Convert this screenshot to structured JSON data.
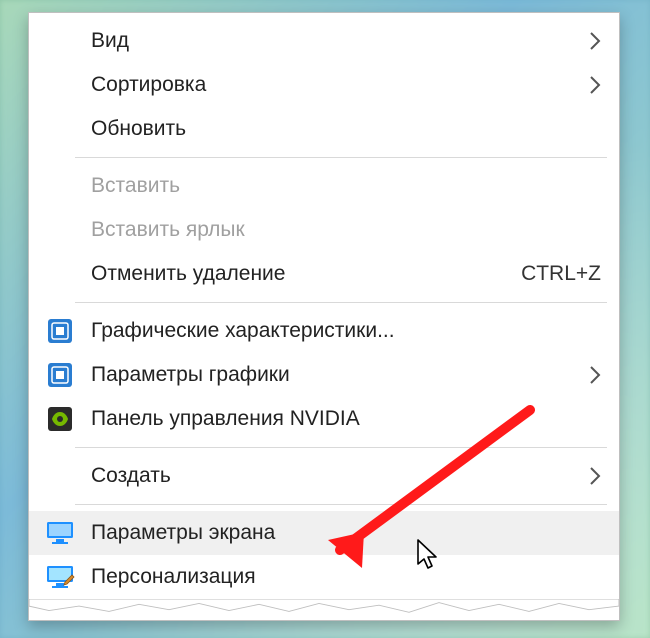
{
  "menu": {
    "items": [
      {
        "label": "Вид",
        "submenu": true,
        "enabled": true,
        "icon": null
      },
      {
        "label": "Сортировка",
        "submenu": true,
        "enabled": true,
        "icon": null
      },
      {
        "label": "Обновить",
        "submenu": false,
        "enabled": true,
        "icon": null
      },
      {
        "sep": true
      },
      {
        "label": "Вставить",
        "submenu": false,
        "enabled": false,
        "icon": null
      },
      {
        "label": "Вставить ярлык",
        "submenu": false,
        "enabled": false,
        "icon": null
      },
      {
        "label": "Отменить удаление",
        "submenu": false,
        "enabled": true,
        "icon": null,
        "shortcut": "CTRL+Z"
      },
      {
        "sep": true
      },
      {
        "label": "Графические характеристики...",
        "submenu": false,
        "enabled": true,
        "icon": "intel-gfx"
      },
      {
        "label": "Параметры графики",
        "submenu": true,
        "enabled": true,
        "icon": "intel-gfx"
      },
      {
        "label": "Панель управления NVIDIA",
        "submenu": false,
        "enabled": true,
        "icon": "nvidia"
      },
      {
        "sep": true
      },
      {
        "label": "Создать",
        "submenu": true,
        "enabled": true,
        "icon": null
      },
      {
        "sep": true
      },
      {
        "label": "Параметры экрана",
        "submenu": false,
        "enabled": true,
        "icon": "display",
        "hovered": true
      },
      {
        "label": "Персонализация",
        "submenu": false,
        "enabled": true,
        "icon": "personalize"
      }
    ]
  },
  "colors": {
    "accent_blue": "#1e90ff",
    "intel_blue": "#2a7dd1",
    "nvidia_green": "#76b900",
    "nvidia_dark": "#2b2b2b",
    "arrow_red": "#ff1a1a"
  }
}
